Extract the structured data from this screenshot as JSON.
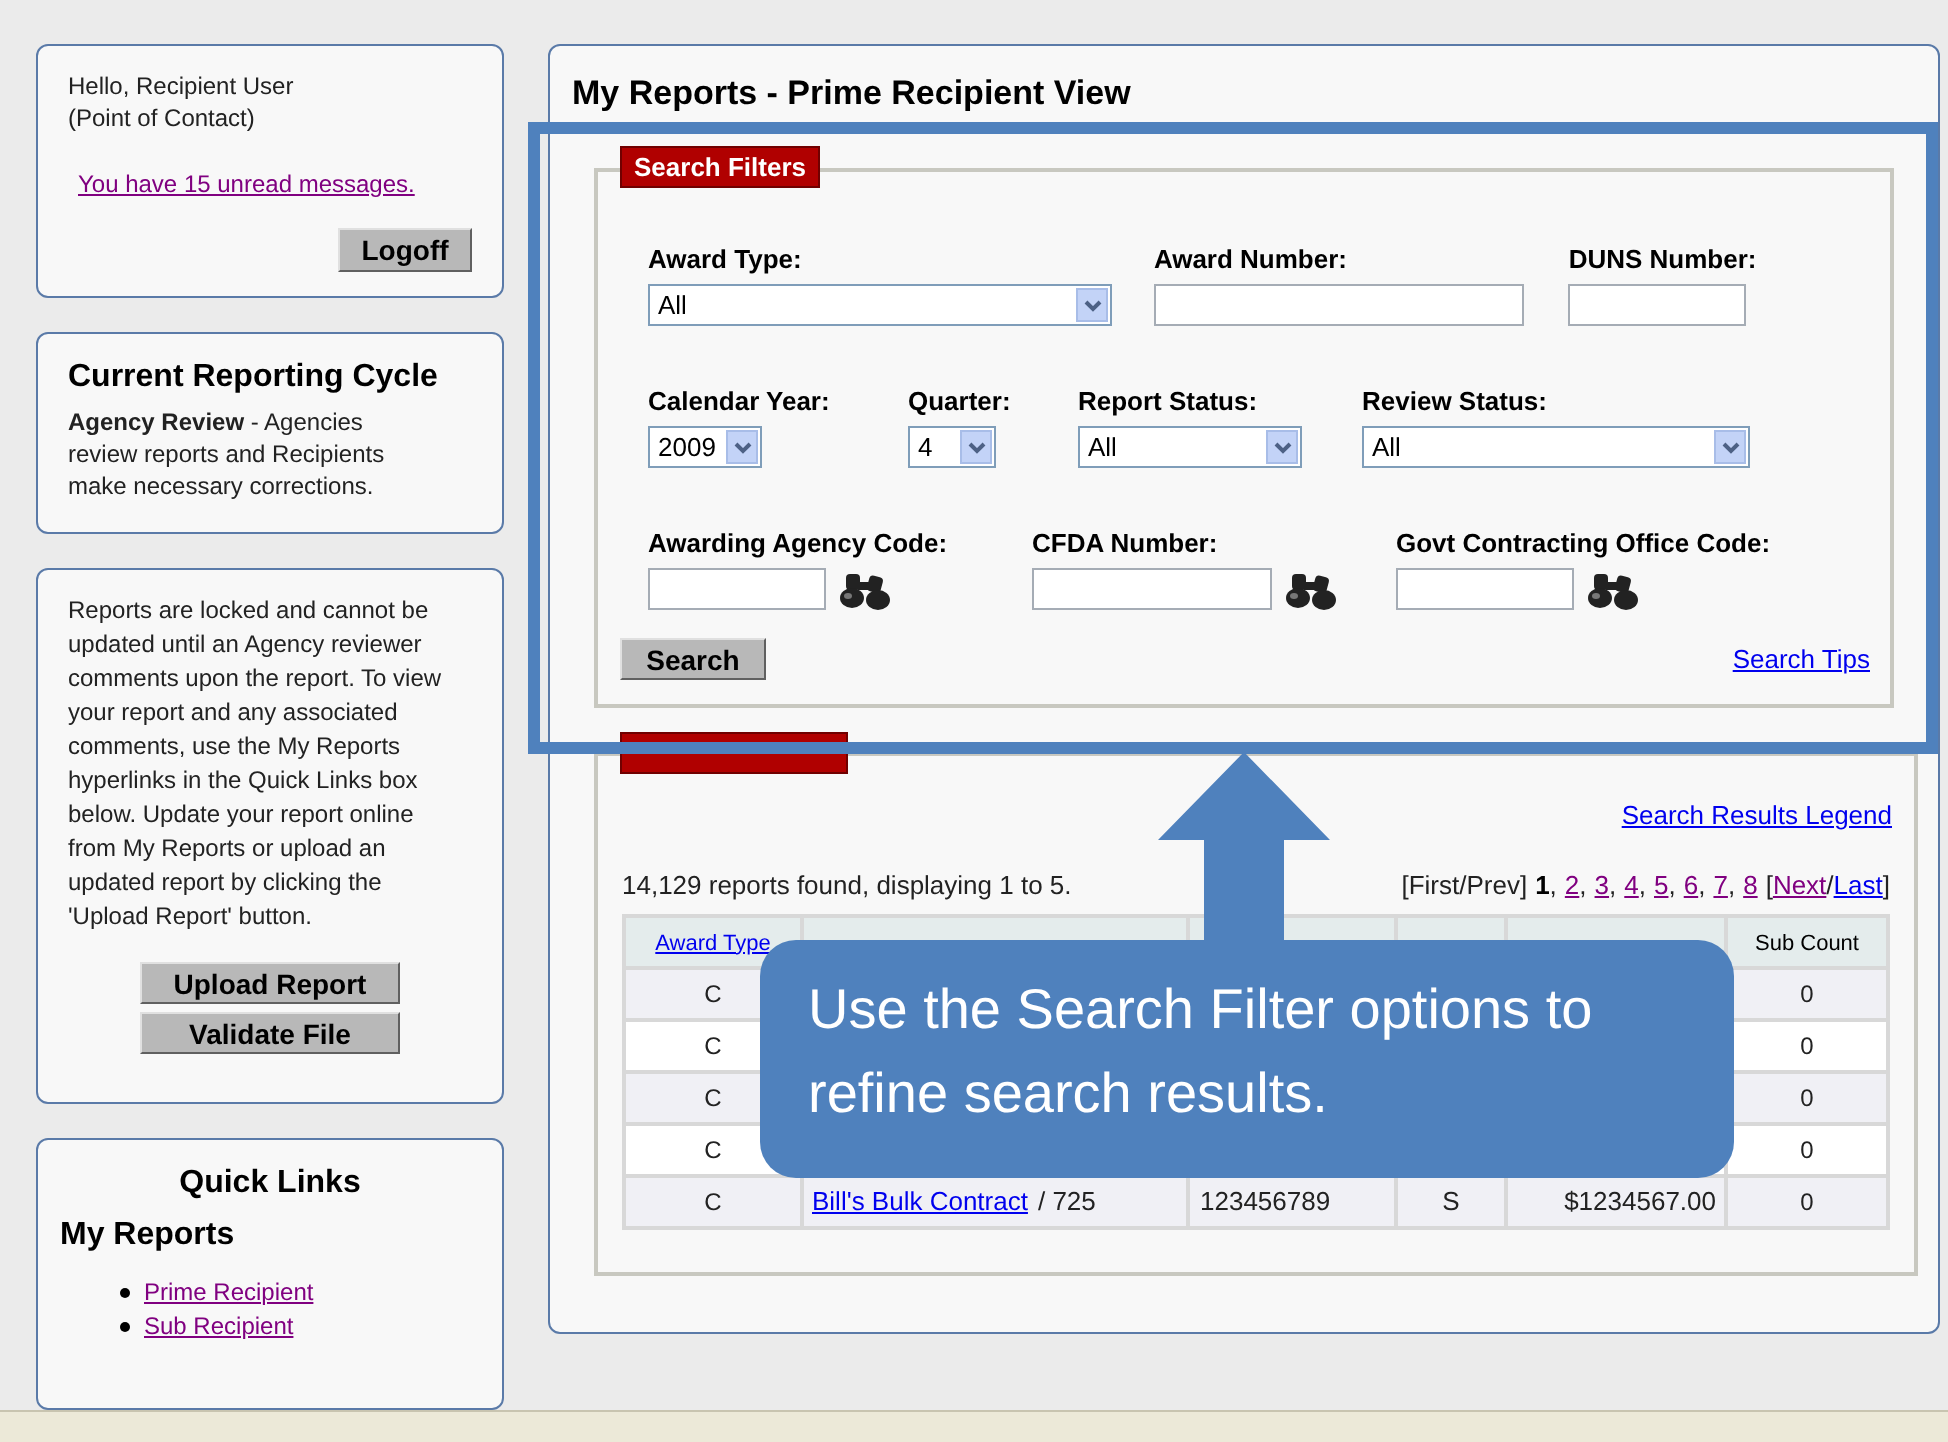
{
  "user_box": {
    "greeting": "Hello, Recipient User",
    "role": "(Point of Contact)",
    "messages_link": "You have 15 unread messages.",
    "logoff_button": "Logoff"
  },
  "cycle_box": {
    "title": "Current Reporting Cycle",
    "description": "**Agency Review** - Agencies review reports and Recipients make necessary corrections."
  },
  "notice_box": {
    "text": "Reports are locked and cannot be updated until an Agency reviewer comments upon the report. To view your report and any associated comments, use the My Reports hyperlinks in the Quick Links box below. Update your report online from My Reports or upload an updated report by clicking the 'Upload Report' button.",
    "buttons": [
      "Upload Report",
      "Validate File"
    ]
  },
  "quick_links": {
    "title": "Quick Links",
    "section": "My Reports",
    "links": [
      "Prime Recipient",
      "Sub Recipient"
    ]
  },
  "main": {
    "title": "My Reports - Prime Recipient View"
  },
  "search_filters": {
    "legend": "Search Filters",
    "rows": [
      [
        {
          "kind": "select",
          "label": "Award Type:",
          "value": "All"
        },
        {
          "kind": "text",
          "label": "Award Number:"
        },
        {
          "kind": "text",
          "label": "DUNS Number:"
        }
      ],
      [
        {
          "kind": "select",
          "label": "Calendar Year:",
          "value": "2009"
        },
        {
          "kind": "select",
          "label": "Quarter:",
          "value": "4"
        },
        {
          "kind": "select",
          "label": "Report Status:",
          "value": "All"
        },
        {
          "kind": "select",
          "label": "Review Status:",
          "value": "All"
        }
      ],
      [
        {
          "kind": "lookup",
          "label": "Awarding Agency Code:"
        },
        {
          "kind": "lookup",
          "label": "CFDA Number:"
        },
        {
          "kind": "lookup",
          "label": "Govt Contracting Office Code:"
        }
      ]
    ],
    "search_button": "Search",
    "tips_link": "Search Tips"
  },
  "search_results": {
    "legend_link": "Search Results Legend",
    "summary": "14,129 reports found, displaying 1 to 5.",
    "pagination": {
      "first_prev": "[First/Prev]",
      "separator": ",",
      "pages": [
        {
          "label": "1",
          "selected": true
        },
        {
          "label": "2",
          "selected": false
        },
        {
          "label": "3",
          "selected": false
        },
        {
          "label": "4",
          "selected": false
        },
        {
          "label": "5",
          "selected": false
        },
        {
          "label": "6",
          "selected": false
        },
        {
          "label": "7",
          "selected": false
        },
        {
          "label": "8",
          "selected": false
        }
      ],
      "open": "[",
      "next": "Next",
      "slash": "/",
      "last": "Last",
      "close": "]"
    },
    "columns": [
      {
        "label": "Award Type",
        "kind": "link"
      },
      {},
      {},
      {},
      {},
      {
        "label": "Sub Count",
        "kind": "text"
      }
    ],
    "rows": [
      {
        "award_type": "C",
        "sub_count": "0"
      },
      {
        "award_type": "C",
        "sub_count": "0"
      },
      {
        "award_type": "C",
        "sub_count": "0"
      },
      {
        "award_type": "C",
        "sub_count": "0"
      },
      {
        "award_type": "C",
        "award_name": "Bill's Bulk Contract",
        "order": "/ 725",
        "duns": "123456789",
        "status": "S",
        "amount": "$1234567.00",
        "sub_count": "0"
      }
    ]
  },
  "annotation": {
    "callout": "Use the Search Filter options to refine search results."
  }
}
